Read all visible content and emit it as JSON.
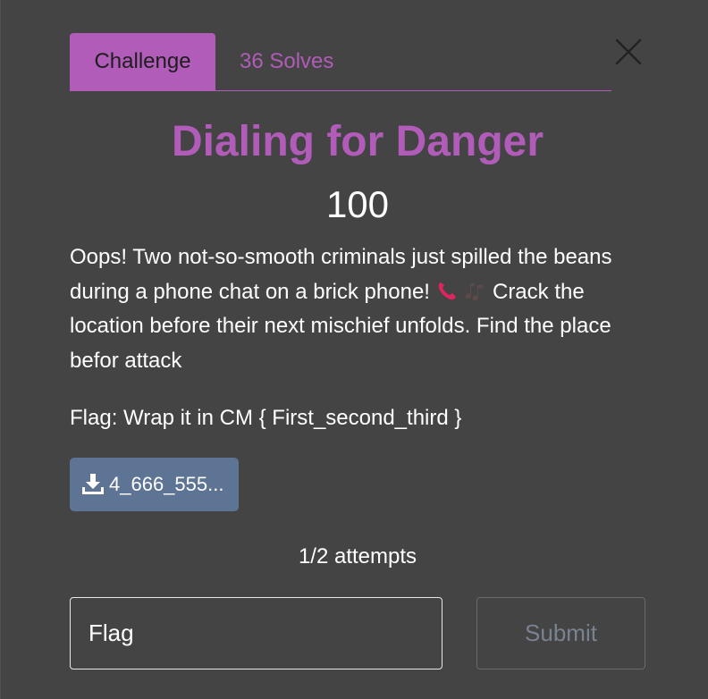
{
  "tabs": {
    "challenge_label": "Challenge",
    "solves_label": "36 Solves"
  },
  "challenge": {
    "title": "Dialing for Danger",
    "points": "100",
    "description_part1": "Oops! Two not-so-smooth criminals just spilled the beans during a phone chat on a brick phone! ",
    "description_part2": " Crack the location before their next mischief unfolds. Find the place befor attack",
    "flag_note": "Flag: Wrap it in CM { First_second_third }"
  },
  "files": {
    "download_label": "4_666_555..."
  },
  "attempts": {
    "text": "1/2 attempts"
  },
  "form": {
    "input_placeholder": "Flag",
    "submit_label": "Submit"
  },
  "icons": {
    "close": "close-icon",
    "download": "download-icon",
    "phone": "telephone-receiver-icon",
    "notes": "musical-notes-icon"
  },
  "colors": {
    "background": "#444444",
    "accent": "#b05cb8",
    "download_button": "#5e7494",
    "text": "#ffffff"
  }
}
